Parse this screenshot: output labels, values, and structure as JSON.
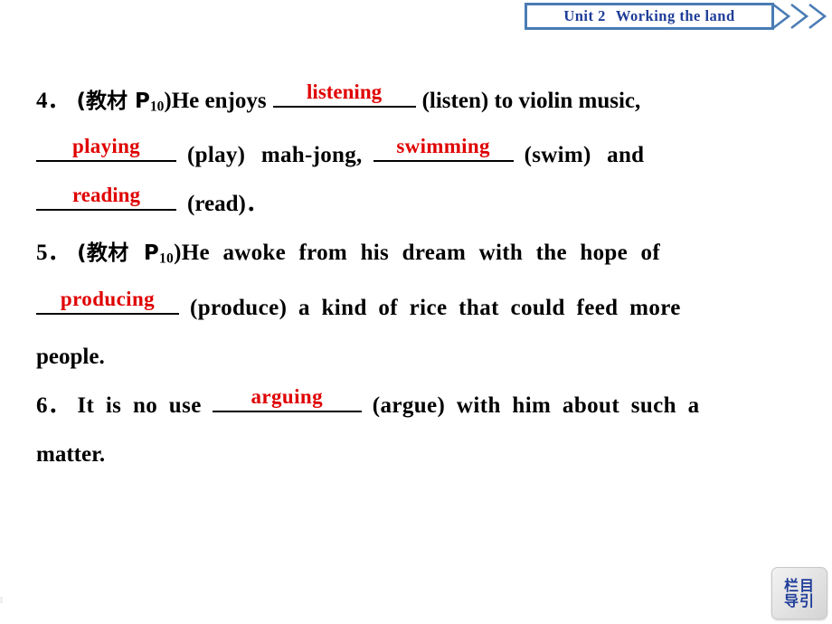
{
  "header": {
    "unit_label": "Unit 2",
    "title": "Working  the land",
    "chevron_icon": "chevron-right-triple-icon",
    "border_color": "#4a7cb5",
    "text_color": "#1f3d99"
  },
  "answer_color": "#e00000",
  "exercises": [
    {
      "number": "4．",
      "source_prefix": "(教材 P",
      "source_page": "10",
      "source_suffix": ")",
      "segments": {
        "s1": "He enjoys",
        "a1": "listening",
        "s2": "(listen) to violin music,",
        "a2": "playing",
        "s3": "(play) mah-jong,",
        "a3": "swimming",
        "s4": "(swim) and",
        "a4": "reading",
        "s5": "(read)．"
      }
    },
    {
      "number": "5．",
      "source_prefix": "(教材 P",
      "source_page": "10",
      "source_suffix": ")",
      "segments": {
        "s1": "He awoke from his dream with the hope of",
        "a1": "producing",
        "s2": "(produce) a kind of rice that could feed more",
        "s3": "people."
      }
    },
    {
      "number": "6．",
      "segments": {
        "s1": "It is no use",
        "a1": "arguing",
        "s2": "(argue) with him about such a",
        "s3": "matter."
      }
    }
  ],
  "corner_button": {
    "line1": "栏目",
    "line2": "导引"
  }
}
